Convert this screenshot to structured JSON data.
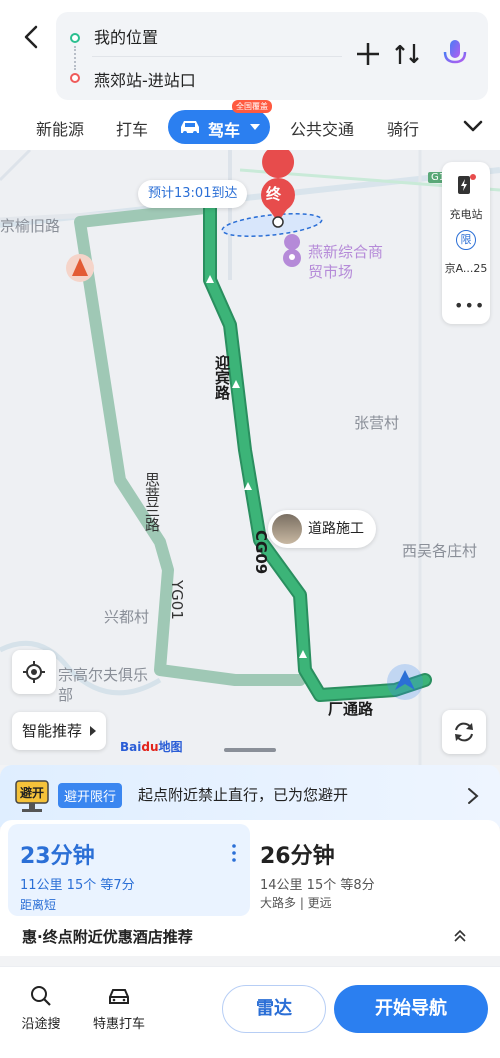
{
  "header": {
    "from": "我的位置",
    "to": "燕郊站-进站口"
  },
  "modes": {
    "items": [
      "新能源",
      "打车",
      "驾车",
      "公共交通",
      "骑行"
    ],
    "active_badge": "全国覆盖"
  },
  "map": {
    "eta_label": "预计13:01到达",
    "end_marker": "终",
    "poi": "燕新综合商贸市场",
    "places": [
      "张营村",
      "西吴各庄村",
      "兴都村",
      "宗高尔夫俱乐部"
    ],
    "roads": [
      "京榆旧路",
      "迎宾路",
      "CG09",
      "思菩兰路",
      "YG01",
      "厂通路"
    ],
    "construction_label": "道路施工",
    "side_panel": {
      "charging": "充电站",
      "restriction": "京A...25",
      "restriction_badge": "限",
      "more": "•••"
    },
    "road_badge": "G1",
    "smart_recommend": "智能推荐",
    "logo_text_a": "Bai",
    "logo_text_b": "du",
    "logo_text_c": "地图"
  },
  "notice": {
    "icon_text": "避开",
    "tag": "避开限行",
    "text": "起点附近禁止直行，已为您避开"
  },
  "routes": [
    {
      "time": "23分钟",
      "info": "11公里  15个  等7分",
      "tag": "距离短"
    },
    {
      "time": "26分钟",
      "info": "14公里  15个  等8分",
      "tag": "大路多 | 更远"
    }
  ],
  "hotel": {
    "text": "惠·终点附近优惠酒店推荐"
  },
  "bottom": {
    "along_search": "沿途搜",
    "taxi": "特惠打车",
    "radar": "雷达",
    "start": "开始导航"
  },
  "colors": {
    "accent": "#2b7ff0",
    "route_main": "#2fa46e",
    "route_alt": "#9fc8b5",
    "destination": "#e74c4c"
  }
}
